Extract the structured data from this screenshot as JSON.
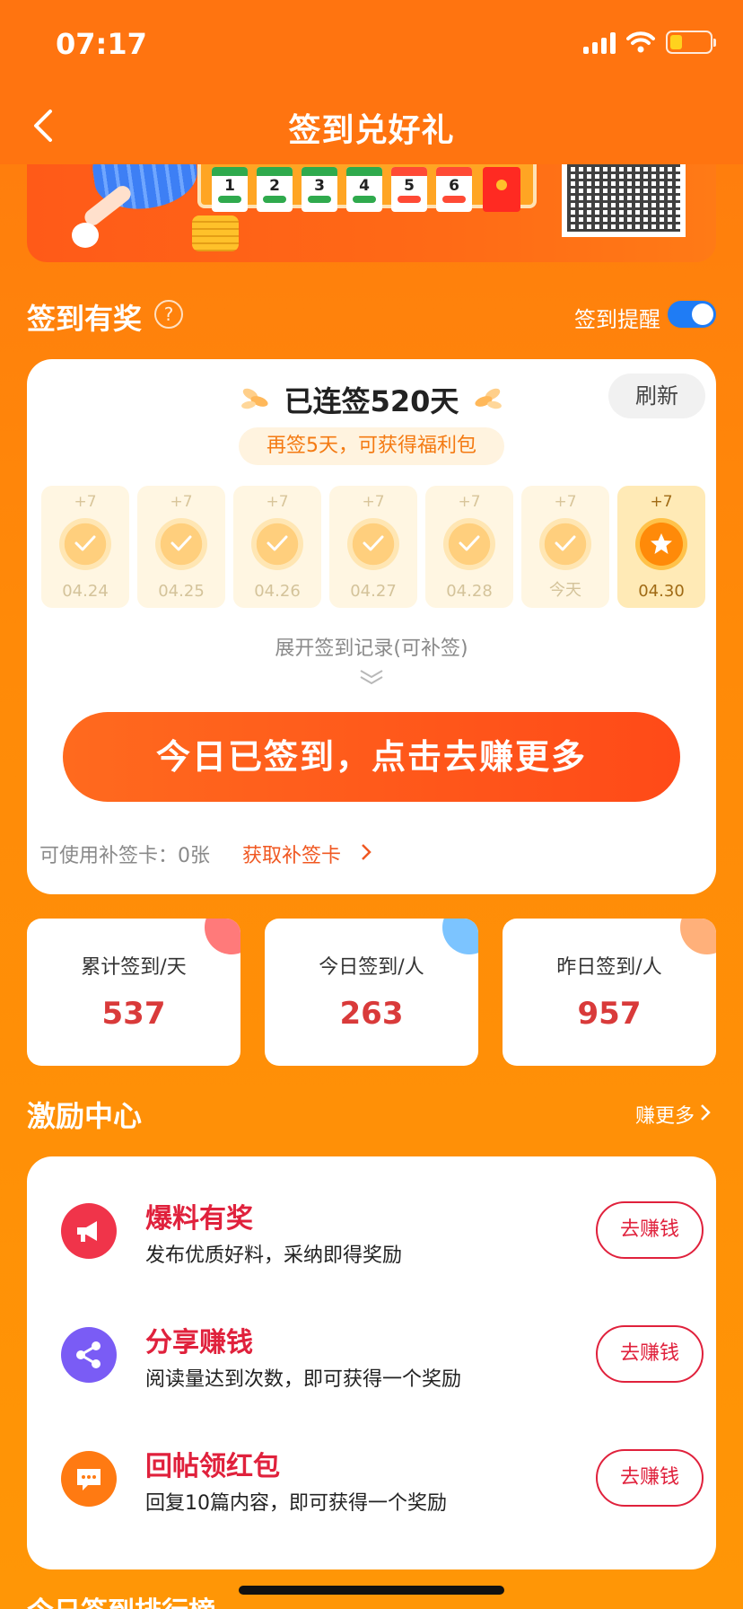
{
  "status_bar": {
    "time": "07:17"
  },
  "nav": {
    "title": "签到兑好礼",
    "back_icon": "chevron-left-icon"
  },
  "banner": {
    "calendar_days": [
      {
        "num": "1",
        "state": "green"
      },
      {
        "num": "2",
        "state": "green"
      },
      {
        "num": "3",
        "state": "green"
      },
      {
        "num": "4",
        "state": "green"
      },
      {
        "num": "5",
        "state": "red"
      },
      {
        "num": "6",
        "state": "red"
      }
    ]
  },
  "signin_section": {
    "title": "签到有奖",
    "help_icon_glyph": "?",
    "reminder_label": "签到提醒",
    "reminder_on": true
  },
  "signin_card": {
    "streak_text": "已连签520天",
    "refresh_label": "刷新",
    "bonus_hint": "再签5天，可获得福利包",
    "days": [
      {
        "points": "+7",
        "date": "04.24",
        "signed": true
      },
      {
        "points": "+7",
        "date": "04.25",
        "signed": true
      },
      {
        "points": "+7",
        "date": "04.26",
        "signed": true
      },
      {
        "points": "+7",
        "date": "04.27",
        "signed": true
      },
      {
        "points": "+7",
        "date": "04.28",
        "signed": true
      },
      {
        "points": "+7",
        "date": "今天",
        "signed": true
      },
      {
        "points": "+7",
        "date": "04.30",
        "signed": false
      }
    ],
    "expand_label": "展开签到记录(可补签)",
    "main_button": "今日已签到，点击去赚更多",
    "makeup_count": "可使用补签卡：0张",
    "makeup_link": "获取补签卡"
  },
  "stats": [
    {
      "label": "累计签到/天",
      "value": "537",
      "corner_color": "#ff7a7a"
    },
    {
      "label": "今日签到/人",
      "value": "263",
      "corner_color": "#7cc4ff"
    },
    {
      "label": "昨日签到/人",
      "value": "957",
      "corner_color": "#ffb07a"
    }
  ],
  "incentive": {
    "title": "激励中心",
    "more_label": "赚更多",
    "tasks": [
      {
        "icon": "megaphone-icon",
        "title": "爆料有奖",
        "desc": "发布优质好料，采纳即得奖励",
        "button": "去赚钱",
        "color": "#f0344a"
      },
      {
        "icon": "share-icon",
        "title": "分享赚钱",
        "desc": "阅读量达到次数，即可获得一个奖励",
        "button": "去赚钱",
        "color": "#7a5cf5"
      },
      {
        "icon": "comment-icon",
        "title": "回帖领红包",
        "desc": "回复10篇内容，即可获得一个奖励",
        "button": "去赚钱",
        "color": "#ff7a12"
      }
    ]
  },
  "ranking": {
    "title_partial": "今日签到排行榜"
  }
}
